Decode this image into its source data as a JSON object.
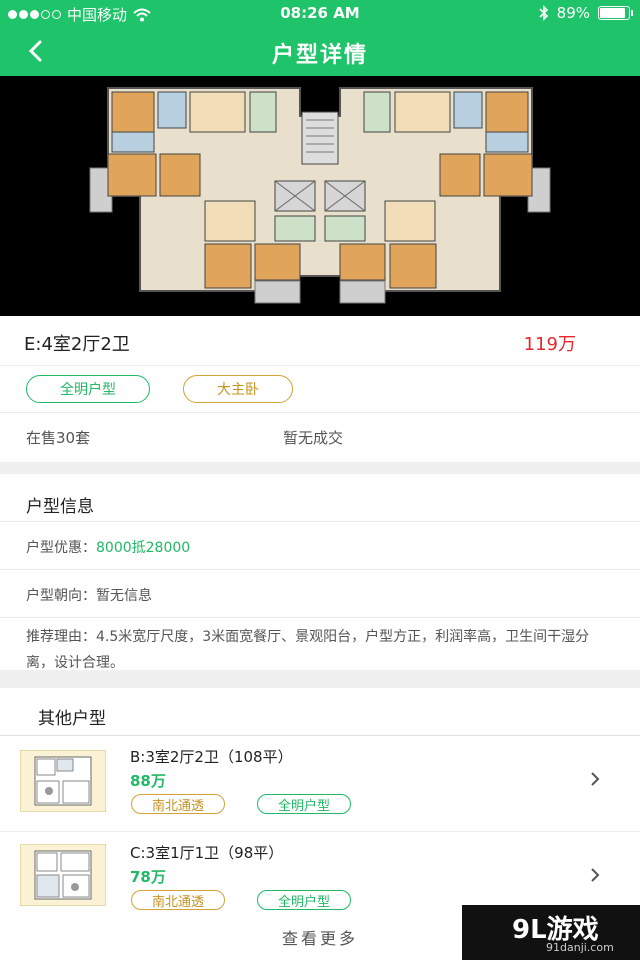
{
  "statusbar": {
    "carrier": "中国移动",
    "time": "08:26 AM",
    "battery": "89%",
    "battery_level": 0.89
  },
  "navbar": {
    "title": "户型详情"
  },
  "unit": {
    "title": "E:4室2厅2卫",
    "price": "119万",
    "tags": [
      "全明户型",
      "大主卧"
    ],
    "on_sale": "在售30套",
    "deals": "暂无成交"
  },
  "info": {
    "title": "户型信息",
    "discount_label": "户型优惠：",
    "discount_value": "8000抵28000",
    "orientation": "户型朝向：暂无信息",
    "reason": "推荐理由：4.5米宽厅尺度，3米面宽餐厅、景观阳台，户型方正，利润率高，卫生间干湿分离，设计合理。"
  },
  "others": {
    "title": "其他户型",
    "items": [
      {
        "name": "B:3室2厅2卫（108平）",
        "price": "88万",
        "tags": [
          "南北通透",
          "全明户型"
        ]
      },
      {
        "name": "C:3室1厅1卫（98平）",
        "price": "78万",
        "tags": [
          "南北通透",
          "全明户型"
        ]
      }
    ],
    "more": "查看更多"
  },
  "watermark": {
    "main": "9L游戏",
    "sub": "91danji.com"
  },
  "colors": {
    "brand": "#1ec36a",
    "price": "#e8262c",
    "tag_green": "#22b866",
    "tag_gold": "#c59320"
  }
}
